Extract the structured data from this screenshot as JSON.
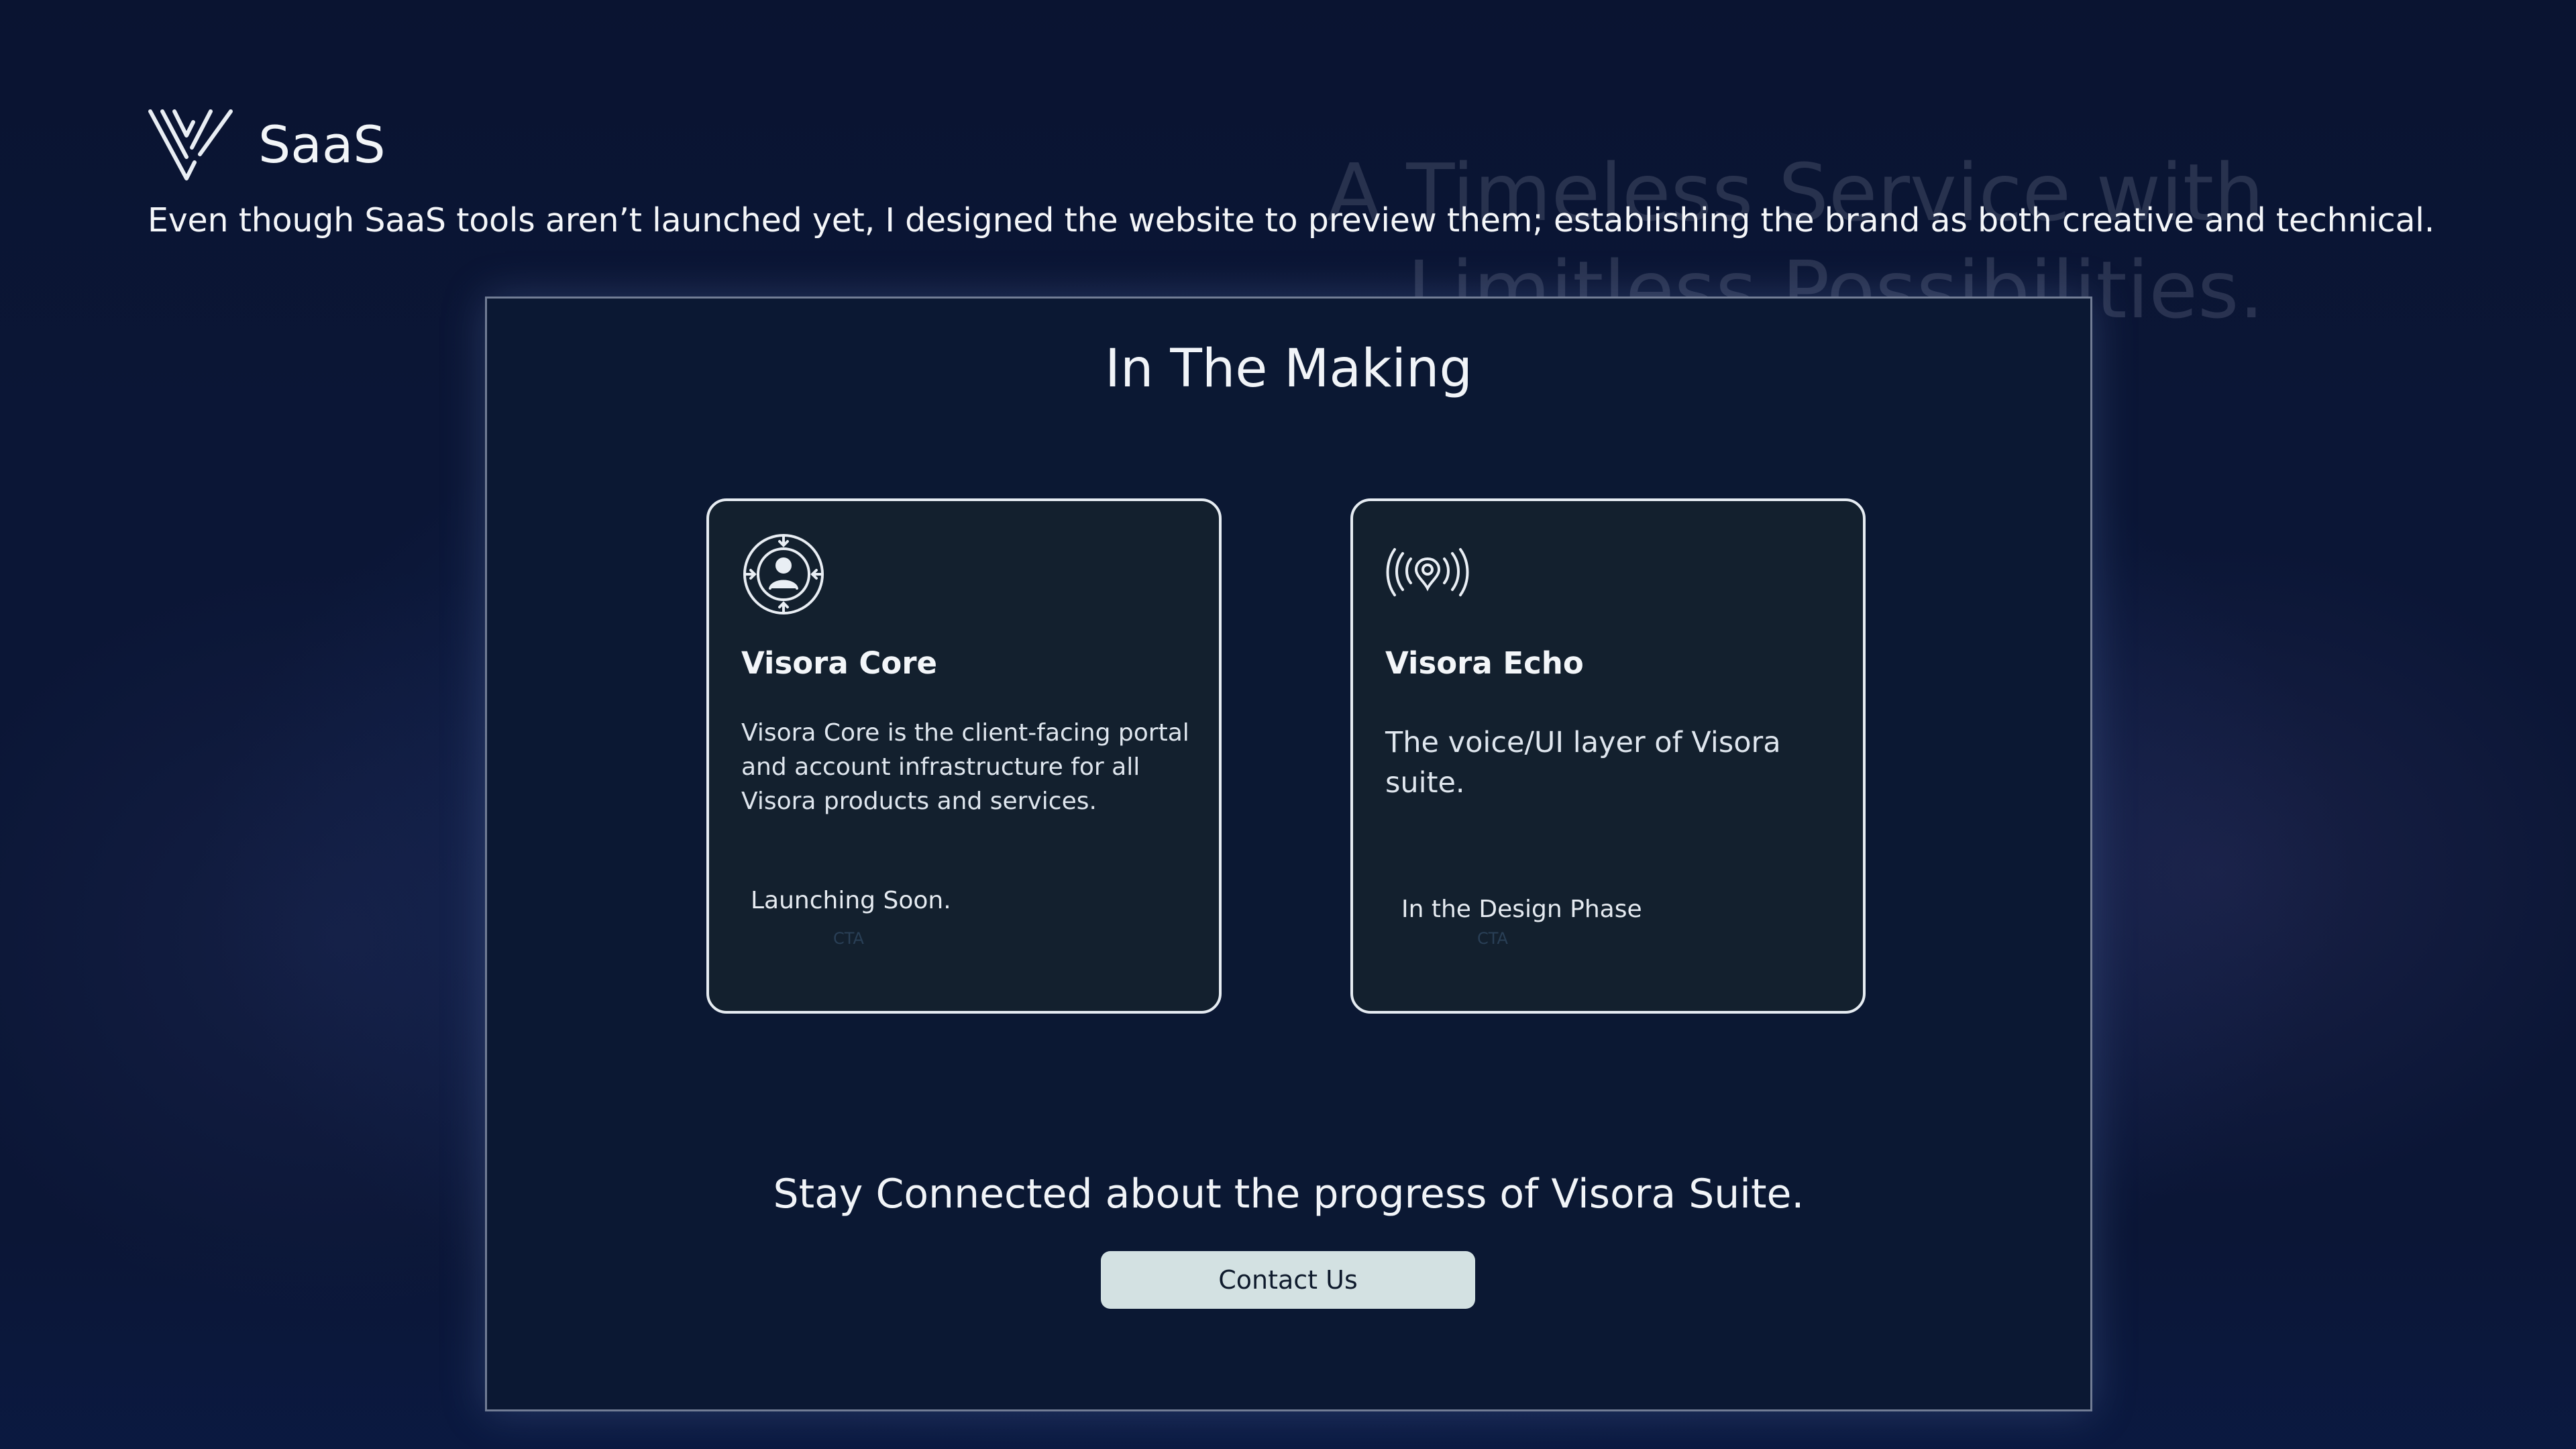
{
  "header": {
    "brand_name": "SaaS",
    "subtitle": "Even though SaaS tools aren’t launched yet, I designed the website to preview them; establishing the brand as both creative and technical."
  },
  "background": {
    "ghost_line_1": "A Timeless Service with",
    "ghost_line_2": "Limitless Possibilities."
  },
  "panel": {
    "title": "In The Making",
    "cards": [
      {
        "icon": "user-circle-arrows-icon",
        "title": "Visora Core",
        "description": "Visora Core is the client-facing portal and account infrastructure for all Visora products and services.",
        "status": "Launching Soon.",
        "cta": "CTA"
      },
      {
        "icon": "voice-waves-icon",
        "title": "Visora Echo",
        "description": "The voice/UI layer of  Visora suite.",
        "status": "In the Design Phase",
        "cta": "CTA"
      }
    ],
    "stay_connected": "Stay Connected about the progress of Visora Suite.",
    "contact_label": "Contact Us"
  },
  "colors": {
    "background": "#0f1d44",
    "panel": "#0b1833",
    "card": "#13202e",
    "card_border": "#e6ecf2",
    "button": "#d3e1e2",
    "button_text": "#0f1b2d"
  }
}
